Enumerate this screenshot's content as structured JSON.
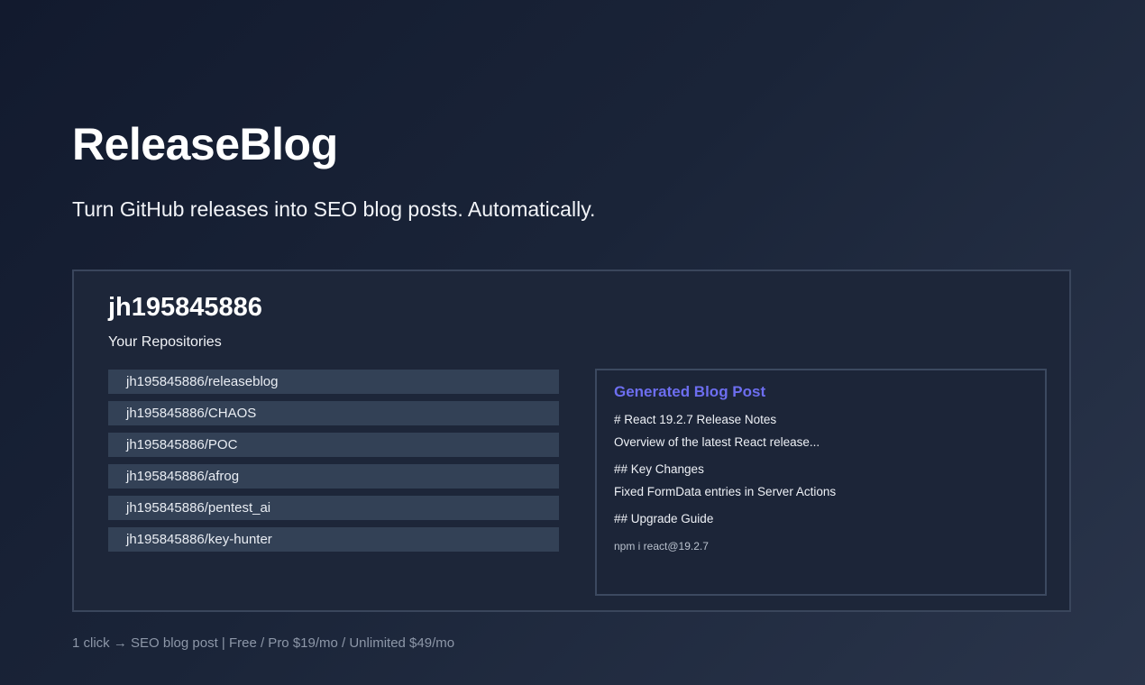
{
  "hero": {
    "title": "ReleaseBlog",
    "subtitle": "Turn GitHub releases into SEO blog posts. Automatically."
  },
  "panel": {
    "username": "jh195845886",
    "repos_heading": "Your Repositories",
    "repositories": [
      "jh195845886/releaseblog",
      "jh195845886/CHAOS",
      "jh195845886/POC",
      "jh195845886/afrog",
      "jh195845886/pentest_ai",
      "jh195845886/key-hunter"
    ]
  },
  "blog_post": {
    "heading": "Generated Blog Post",
    "lines": [
      "# React 19.2.7 Release Notes",
      "Overview of the latest React release...",
      "## Key Changes",
      "Fixed FormData entries in Server Actions",
      "## Upgrade Guide"
    ],
    "code": "npm i react@19.2.7",
    "accent_color": "#6d6ef0"
  },
  "footer": {
    "text": "1 click → SEO blog post | Free / Pro $19/mo / Unlimited $49/mo"
  }
}
